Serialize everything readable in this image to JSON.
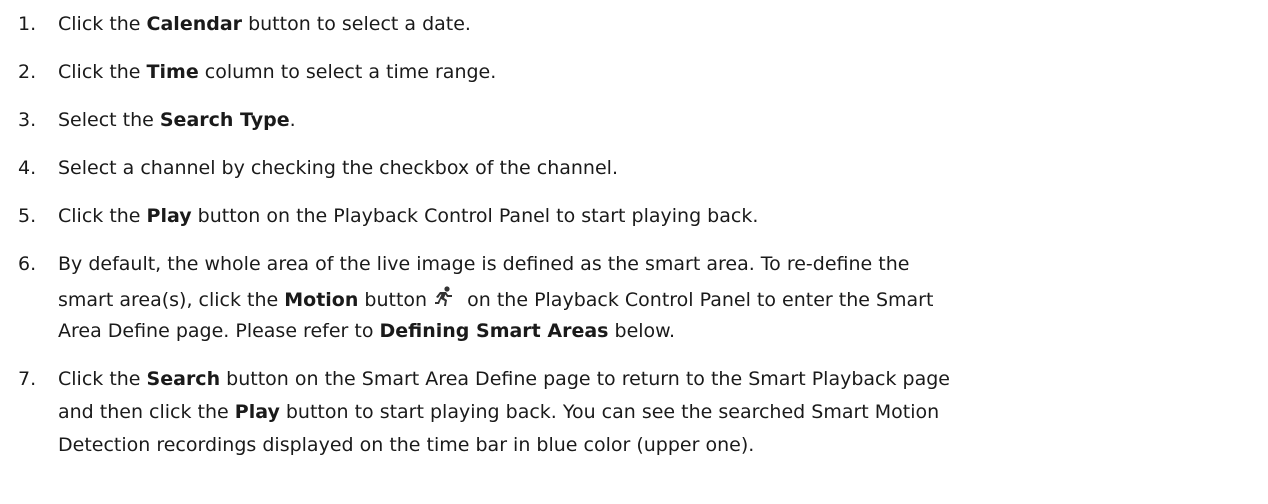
{
  "steps": [
    {
      "num": "1.",
      "parts": [
        "Click the ",
        "Calendar",
        " button to select a date."
      ]
    },
    {
      "num": "2.",
      "parts": [
        "Click the ",
        "Time",
        " column to select a time range."
      ]
    },
    {
      "num": "3.",
      "parts": [
        "Select the ",
        "Search Type",
        "."
      ]
    },
    {
      "num": "4.",
      "text": "Select a channel by checking the checkbox of the channel."
    },
    {
      "num": "5.",
      "parts": [
        "Click the ",
        "Play",
        " button on the Playback Control Panel to start playing back."
      ]
    },
    {
      "num": "6.",
      "line1": "By default, the whole area of the live image is defined as the smart area. To re-define the",
      "line2_a": "smart area(s), click the ",
      "line2_b": "Motion",
      "line2_c": " button",
      "line2_d": " on the Playback Control Panel to enter the Smart",
      "line3_a": "Area Define page. Please refer to ",
      "line3_b": "Defining Smart Areas",
      "line3_c": " below.",
      "icon": "running-person-icon"
    },
    {
      "num": "7.",
      "line1_a": "Click the ",
      "line1_b": "Search",
      "line1_c": " button on the Smart Area Define page to return to the Smart Playback page",
      "line2_a": "and then click the ",
      "line2_b": "Play",
      "line2_c": " button to start playing back. You can see the searched Smart Motion",
      "line3": "Detection recordings displayed on the time bar in blue color (upper one)."
    }
  ]
}
